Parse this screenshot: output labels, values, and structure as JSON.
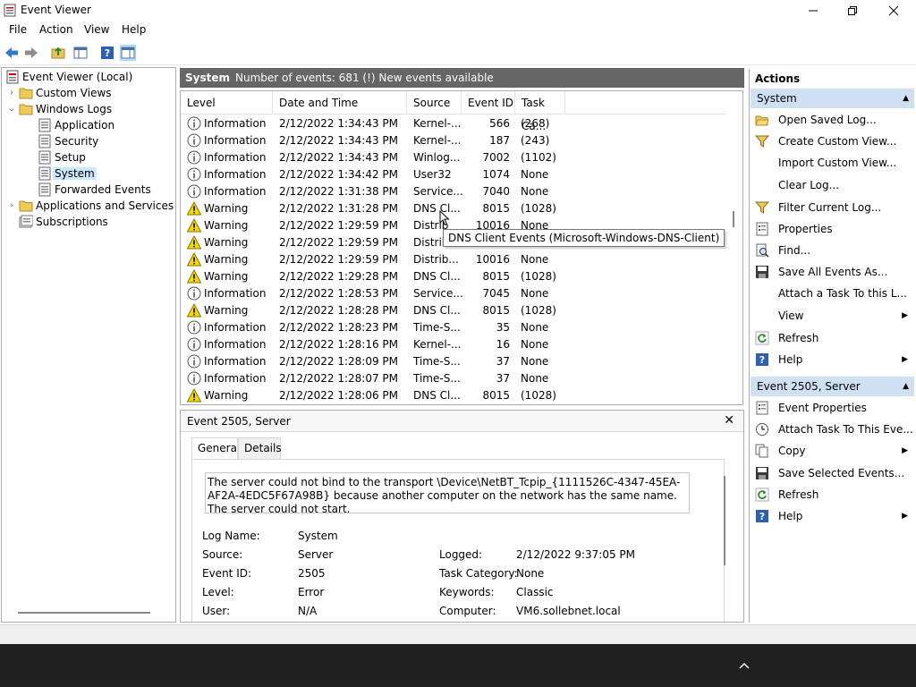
{
  "window": {
    "title": "Event Viewer"
  },
  "menu": [
    "File",
    "Action",
    "View",
    "Help"
  ],
  "tree": [
    {
      "label": "Event Viewer (Local)",
      "arrow": "",
      "icon": "event-viewer-icon"
    },
    {
      "label": "Custom Views",
      "arrow": "›",
      "icon": "folder-icon"
    },
    {
      "label": "Windows Logs",
      "arrow": "⌄",
      "icon": "folder-icon"
    },
    {
      "label": "Application",
      "arrow": "",
      "icon": "log-icon"
    },
    {
      "label": "Security",
      "arrow": "",
      "icon": "log-icon"
    },
    {
      "label": "Setup",
      "arrow": "",
      "icon": "log-icon"
    },
    {
      "label": "System",
      "arrow": "",
      "icon": "log-icon"
    },
    {
      "label": "Forwarded Events",
      "arrow": "",
      "icon": "log-icon"
    },
    {
      "label": "Applications and Services Lo",
      "arrow": "›",
      "icon": "folder-icon"
    },
    {
      "label": "Subscriptions",
      "arrow": "",
      "icon": "subscriptions-icon"
    }
  ],
  "center": {
    "name": "System",
    "info": "Number of events: 681 (!) New events available",
    "columns": [
      "Level",
      "Date and Time",
      "Source",
      "Event ID",
      "Task Ca..."
    ],
    "rows": [
      {
        "level": "Information",
        "date": "2/12/2022 1:34:43 PM",
        "source": "Kernel-...",
        "id": "566",
        "task": "(268)"
      },
      {
        "level": "Information",
        "date": "2/12/2022 1:34:43 PM",
        "source": "Kernel-...",
        "id": "187",
        "task": "(243)"
      },
      {
        "level": "Information",
        "date": "2/12/2022 1:34:43 PM",
        "source": "Winlog...",
        "id": "7002",
        "task": "(1102)"
      },
      {
        "level": "Information",
        "date": "2/12/2022 1:34:42 PM",
        "source": "User32",
        "id": "1074",
        "task": "None"
      },
      {
        "level": "Information",
        "date": "2/12/2022 1:31:38 PM",
        "source": "Service...",
        "id": "7040",
        "task": "None"
      },
      {
        "level": "Warning",
        "date": "2/12/2022 1:31:28 PM",
        "source": "DNS Cl...",
        "id": "8015",
        "task": "(1028)"
      },
      {
        "level": "Warning",
        "date": "2/12/2022 1:29:59 PM",
        "source": "Distrib",
        "id": "10016",
        "task": "None"
      },
      {
        "level": "Warning",
        "date": "2/12/2022 1:29:59 PM",
        "source": "Distrib",
        "id": "",
        "task": ""
      },
      {
        "level": "Warning",
        "date": "2/12/2022 1:29:59 PM",
        "source": "Distrib...",
        "id": "10016",
        "task": "None"
      },
      {
        "level": "Warning",
        "date": "2/12/2022 1:29:28 PM",
        "source": "DNS Cl...",
        "id": "8015",
        "task": "(1028)"
      },
      {
        "level": "Information",
        "date": "2/12/2022 1:28:53 PM",
        "source": "Service...",
        "id": "7045",
        "task": "None"
      },
      {
        "level": "Warning",
        "date": "2/12/2022 1:28:28 PM",
        "source": "DNS Cl...",
        "id": "8015",
        "task": "(1028)"
      },
      {
        "level": "Information",
        "date": "2/12/2022 1:28:23 PM",
        "source": "Time-S...",
        "id": "35",
        "task": "None"
      },
      {
        "level": "Information",
        "date": "2/12/2022 1:28:16 PM",
        "source": "Kernel-...",
        "id": "16",
        "task": "None"
      },
      {
        "level": "Information",
        "date": "2/12/2022 1:28:09 PM",
        "source": "Time-S...",
        "id": "37",
        "task": "None"
      },
      {
        "level": "Information",
        "date": "2/12/2022 1:28:07 PM",
        "source": "Time-S...",
        "id": "37",
        "task": "None"
      },
      {
        "level": "Warning",
        "date": "2/12/2022 1:28:06 PM",
        "source": "DNS Cl...",
        "id": "8015",
        "task": "(1028)"
      }
    ],
    "tooltip": "DNS Client Events (Microsoft-Windows-DNS-Client)"
  },
  "detail": {
    "title": "Event 2505, Server",
    "tabs": [
      "General",
      "Details"
    ],
    "message": "The server could not bind to the transport \\Device\\NetBT_Tcpip_{1111526C-4347-45EA-AF2A-4EDC5F67A98B} because another computer on the network has the same name.  The server could not start.",
    "fields_left": [
      {
        "key": "Log Name:",
        "value": "System"
      },
      {
        "key": "Source:",
        "value": "Server"
      },
      {
        "key": "Event ID:",
        "value": "2505"
      },
      {
        "key": "Level:",
        "value": "Error"
      },
      {
        "key": "User:",
        "value": "N/A"
      }
    ],
    "fields_right": [
      {
        "key": "Logged:",
        "value": "2/12/2022 9:37:05 PM"
      },
      {
        "key": "Task Category:",
        "value": "None"
      },
      {
        "key": "Keywords:",
        "value": "Classic"
      },
      {
        "key": "Computer:",
        "value": "VM6.sollebnet.local"
      }
    ]
  },
  "actions": {
    "title": "Actions",
    "sections": [
      {
        "name": "System",
        "items": [
          {
            "label": "Open Saved Log...",
            "icon": "open-log-icon",
            "submenu": false
          },
          {
            "label": "Create Custom View...",
            "icon": "filter-icon",
            "submenu": false
          },
          {
            "label": "Import Custom View...",
            "icon": "",
            "submenu": false
          },
          {
            "label": "Clear Log...",
            "icon": "",
            "submenu": false
          },
          {
            "label": "Filter Current Log...",
            "icon": "filter-icon",
            "submenu": false
          },
          {
            "label": "Properties",
            "icon": "properties-icon",
            "submenu": false
          },
          {
            "label": "Find...",
            "icon": "find-icon",
            "submenu": false
          },
          {
            "label": "Save All Events As...",
            "icon": "save-icon",
            "submenu": false
          },
          {
            "label": "Attach a Task To this L...",
            "icon": "",
            "submenu": false
          },
          {
            "label": "View",
            "icon": "",
            "submenu": true
          },
          {
            "label": "Refresh",
            "icon": "refresh-icon",
            "submenu": false
          },
          {
            "label": "Help",
            "icon": "help-icon",
            "submenu": true
          }
        ]
      },
      {
        "name": "Event 2505, Server",
        "items": [
          {
            "label": "Event Properties",
            "icon": "properties-icon",
            "submenu": false
          },
          {
            "label": "Attach Task To This Eve...",
            "icon": "task-icon",
            "submenu": false
          },
          {
            "label": "Copy",
            "icon": "copy-icon",
            "submenu": true
          },
          {
            "label": "Save Selected Events...",
            "icon": "save-icon",
            "submenu": false
          },
          {
            "label": "Refresh",
            "icon": "refresh-icon",
            "submenu": false
          },
          {
            "label": "Help",
            "icon": "help-icon",
            "submenu": true
          }
        ]
      }
    ]
  },
  "colors": {
    "header_bg": "#666666",
    "section_bg": "#cfe0f3",
    "selection": "#cce8ff",
    "warning": "#f5d800",
    "taskbar": "#202020"
  }
}
